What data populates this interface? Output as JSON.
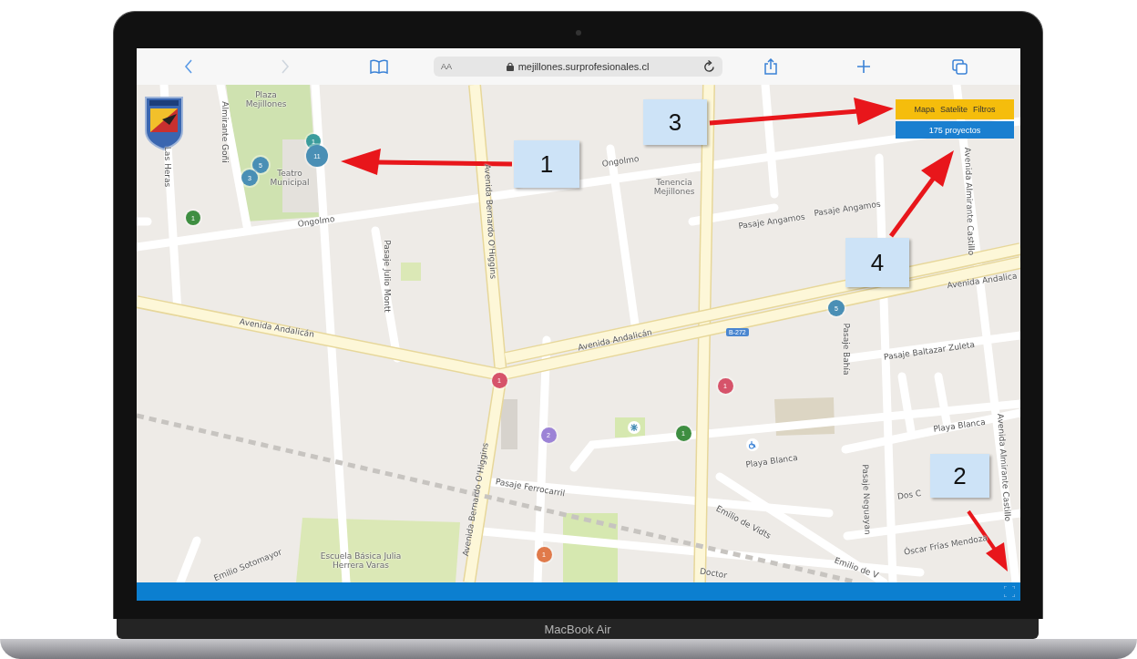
{
  "browser": {
    "reader_label": "AA",
    "url": "mejillones.surprofesionales.cl"
  },
  "map": {
    "street_labels": [
      {
        "text": "Plaza Mejillones",
        "kind": "place"
      },
      {
        "text": "Almirante Goñi",
        "kind": "street"
      },
      {
        "text": "Las Heras",
        "kind": "street"
      },
      {
        "text": "Teatro Municipal",
        "kind": "place"
      },
      {
        "text": "Ongolmo",
        "kind": "street"
      },
      {
        "text": "Ongolmo",
        "kind": "street"
      },
      {
        "text": "Avenida Bernardo O'Higgins",
        "kind": "street"
      },
      {
        "text": "Pasaje Julio Montt",
        "kind": "street"
      },
      {
        "text": "Avenida Andalicán",
        "kind": "street"
      },
      {
        "text": "Avenida Andalicán",
        "kind": "street"
      },
      {
        "text": "Tenencia Mejillones",
        "kind": "place"
      },
      {
        "text": "Pasaje Angamos",
        "kind": "street"
      },
      {
        "text": "Pasaje Angamos",
        "kind": "street"
      },
      {
        "text": "Avenida Almirante Castillo",
        "kind": "street"
      },
      {
        "text": "Avenida Andalica",
        "kind": "street"
      },
      {
        "text": "Pasaje Bahía",
        "kind": "street"
      },
      {
        "text": "Pasaje Baltazar Zuleta",
        "kind": "street"
      },
      {
        "text": "Playa Blanca",
        "kind": "street"
      },
      {
        "text": "Avenida Almirante Castillo",
        "kind": "street"
      },
      {
        "text": "Playa Blanca",
        "kind": "street"
      },
      {
        "text": "Pasaje Ferrocarril",
        "kind": "street"
      },
      {
        "text": "Dos C",
        "kind": "street"
      },
      {
        "text": "Emilio de Vidts",
        "kind": "street"
      },
      {
        "text": "Pasaje Neguayan",
        "kind": "street"
      },
      {
        "text": "Óscar Frías Mendoza",
        "kind": "street"
      },
      {
        "text": "Emilio de V",
        "kind": "street"
      },
      {
        "text": "Doctor",
        "kind": "street"
      },
      {
        "text": "Avenida Bernardo O'Higgins",
        "kind": "street"
      },
      {
        "text": "Escuela Básica Julia Herrera Varas",
        "kind": "place"
      },
      {
        "text": "Emilio Sotomayor",
        "kind": "street"
      }
    ],
    "route_shield": "B-272",
    "markers": [
      {
        "count": "1",
        "color": "#3b9c9c"
      },
      {
        "count": "11",
        "color": "#4a8fb5"
      },
      {
        "count": "5",
        "color": "#4a8fb5"
      },
      {
        "count": "3",
        "color": "#4a8fb5"
      },
      {
        "count": "1",
        "color": "#3e8e41"
      },
      {
        "count": "5",
        "color": "#4a8fb5"
      },
      {
        "count": "1",
        "color": "#d6536a"
      },
      {
        "count": "1",
        "color": "#d6536a"
      },
      {
        "count": "2",
        "color": "#9c83d6"
      },
      {
        "count": "1",
        "color": "#3e8e41"
      },
      {
        "count": "1",
        "color": "#e07a4a"
      }
    ]
  },
  "map_controls": {
    "layers": [
      {
        "label": "Mapa"
      },
      {
        "label": "Satelite"
      },
      {
        "label": "Filtros"
      }
    ],
    "count": "175 proyectos"
  },
  "callouts": [
    {
      "number": "1"
    },
    {
      "number": "3"
    },
    {
      "number": "4"
    },
    {
      "number": "2"
    }
  ],
  "laptop": {
    "label": "MacBook Air"
  }
}
